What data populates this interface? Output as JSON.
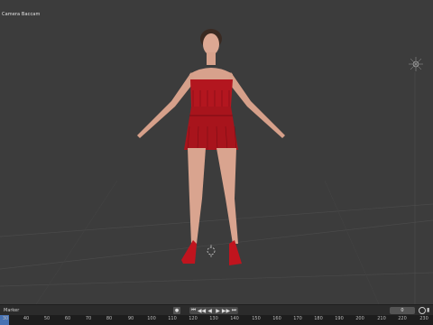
{
  "viewport": {
    "label": "Camera Baccam"
  },
  "timeline": {
    "marker_label": "Marker",
    "current_frame": "0",
    "playhead_label": "",
    "transport": [
      "⏮",
      "◀◀",
      "◀",
      "▶",
      "▶▶",
      "⏭"
    ],
    "ruler_ticks": [
      "30",
      "40",
      "50",
      "60",
      "70",
      "80",
      "90",
      "100",
      "110",
      "120",
      "130",
      "140",
      "150",
      "160",
      "170",
      "180",
      "190",
      "200",
      "210",
      "220",
      "230"
    ]
  },
  "colors": {
    "dress": "#b3161f",
    "skin": "#d9a58f",
    "background": "#3c3c3c",
    "grid": "#4a4a4a",
    "horizon": "#555555"
  }
}
